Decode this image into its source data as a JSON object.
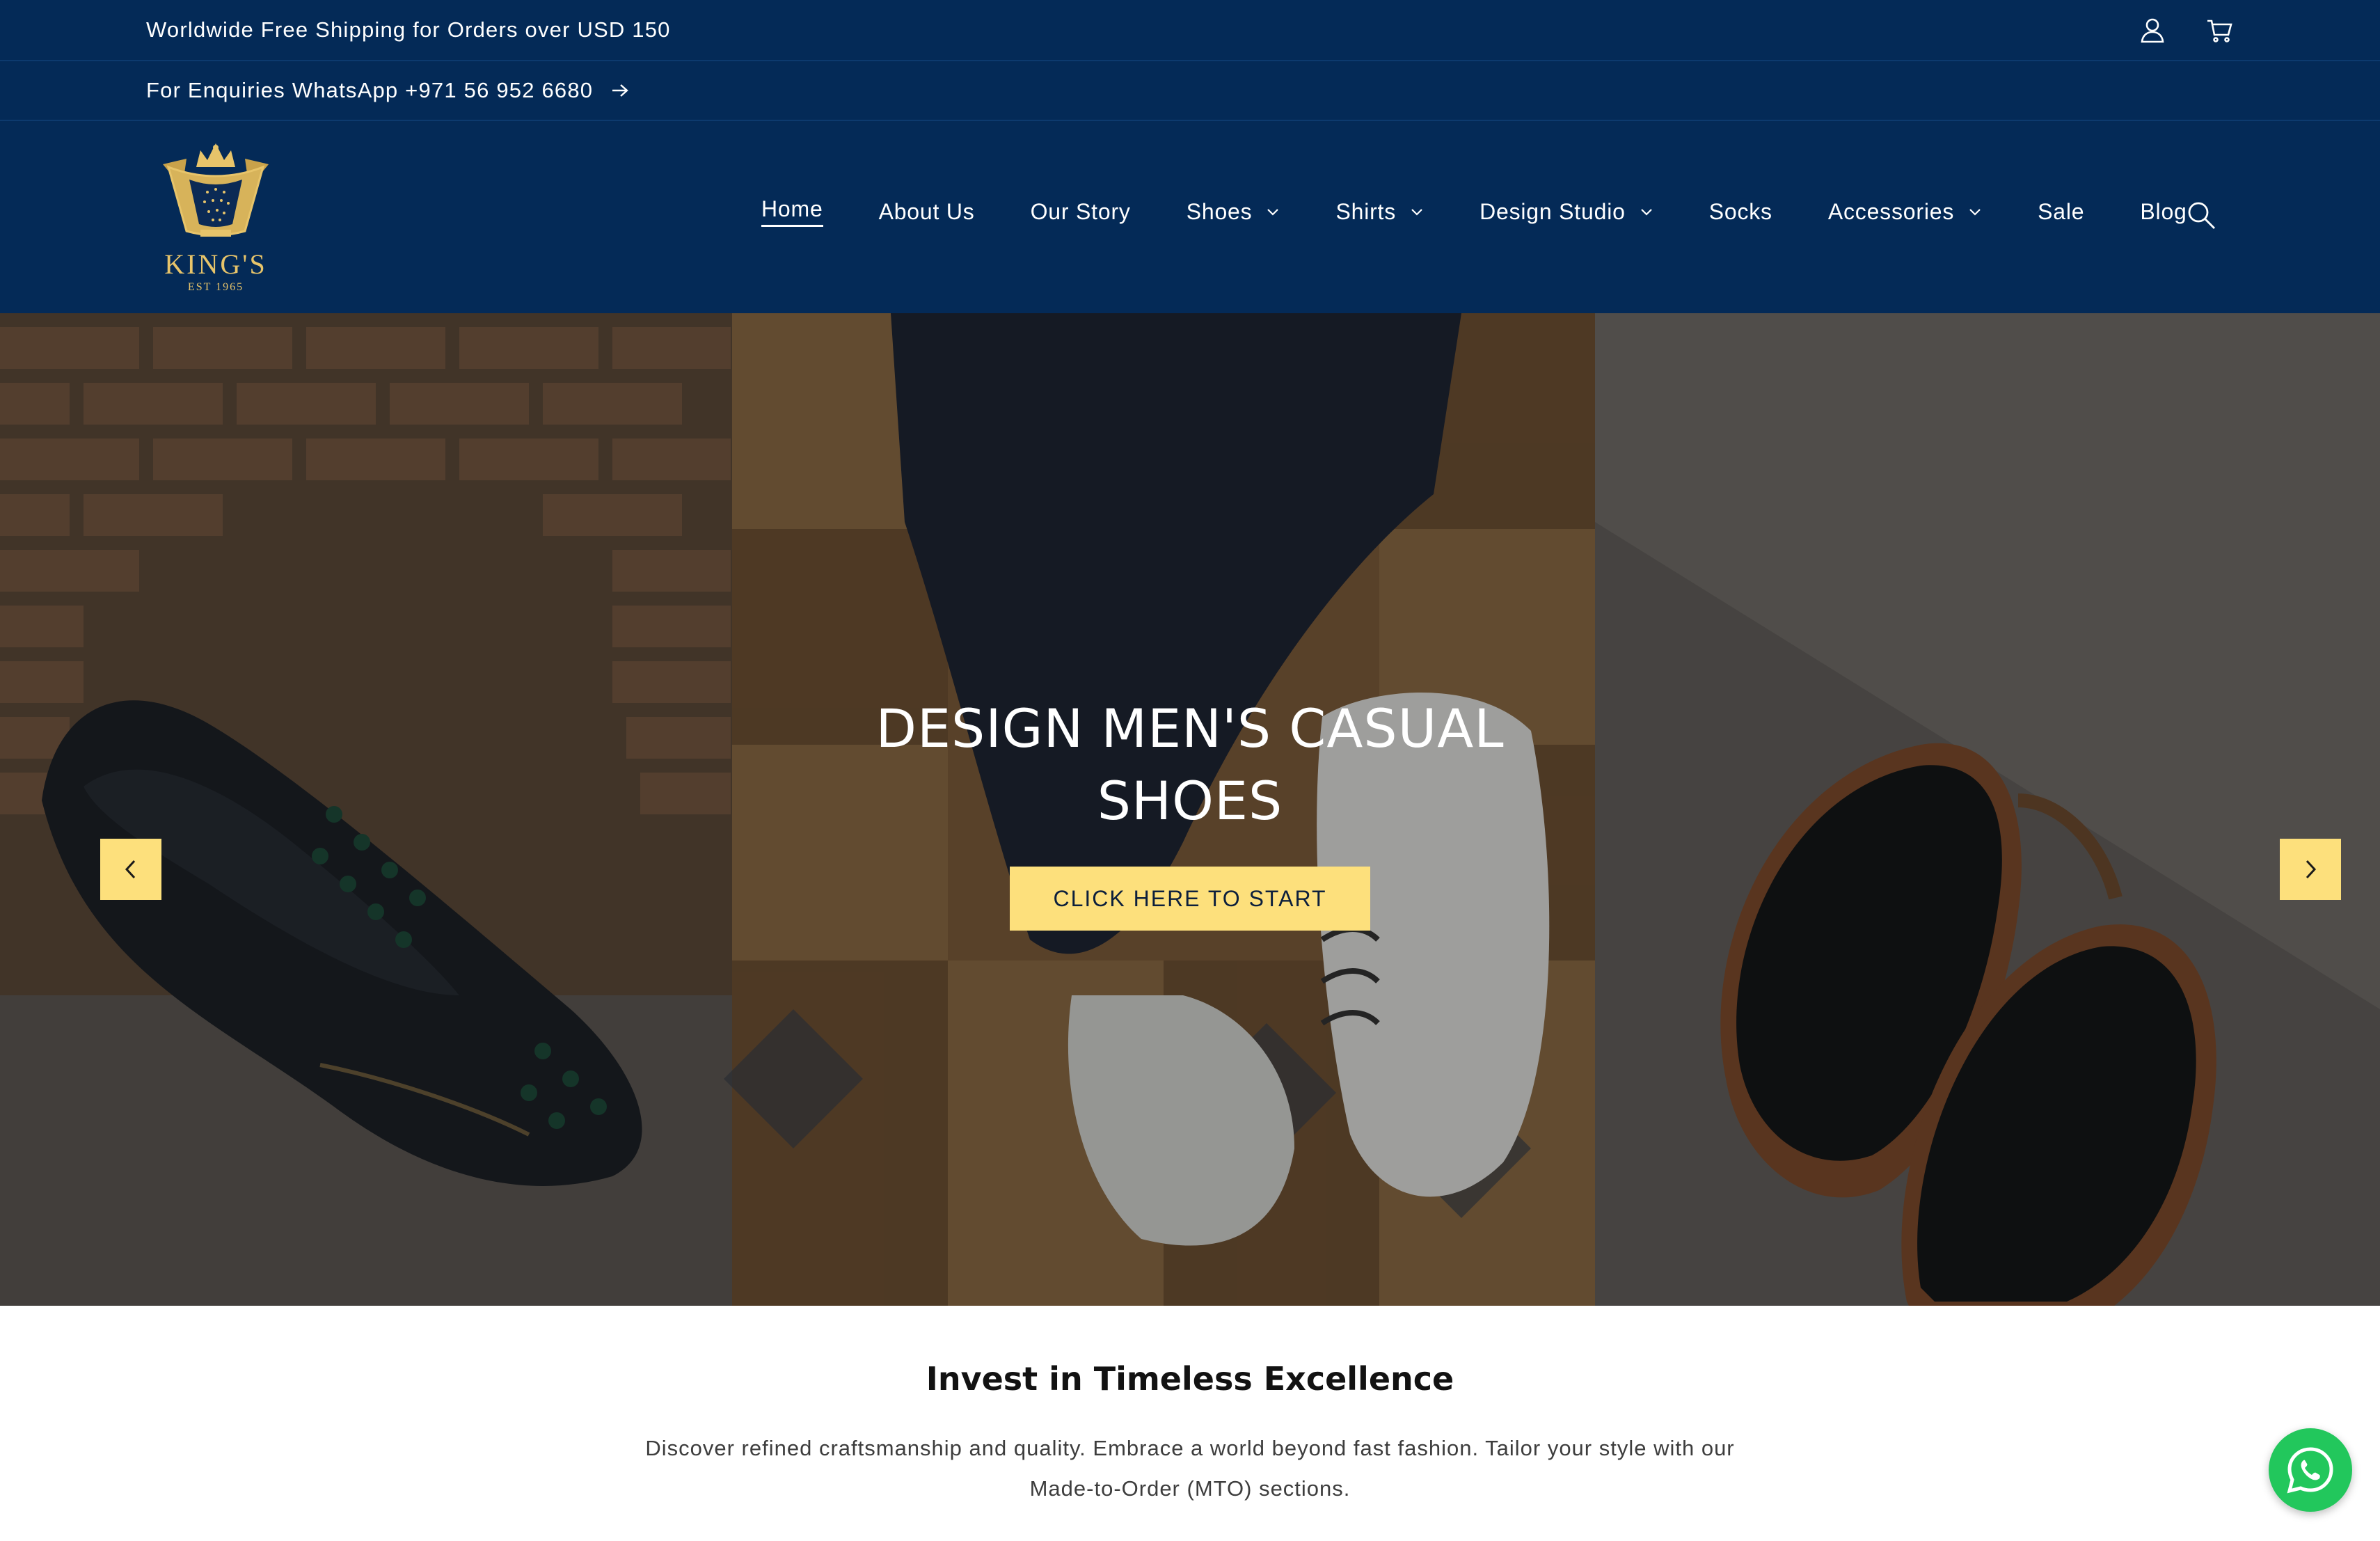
{
  "announcement": {
    "shipping_text": "Worldwide Free Shipping for Orders over USD 150",
    "enquiries_text": "For Enquiries WhatsApp +971 56 952 6680"
  },
  "header_icons": [
    "account-icon",
    "cart-icon",
    "search-icon"
  ],
  "logo": {
    "wordmark": "KING'S",
    "established": "EST 1965"
  },
  "nav": {
    "items": [
      {
        "label": "Home",
        "active": true,
        "dropdown": false
      },
      {
        "label": "About Us",
        "active": false,
        "dropdown": false
      },
      {
        "label": "Our Story",
        "active": false,
        "dropdown": false
      },
      {
        "label": "Shoes",
        "active": false,
        "dropdown": true
      },
      {
        "label": "Shirts",
        "active": false,
        "dropdown": true
      },
      {
        "label": "Design Studio",
        "active": false,
        "dropdown": true
      },
      {
        "label": "Socks",
        "active": false,
        "dropdown": false
      },
      {
        "label": "Accessories",
        "active": false,
        "dropdown": true
      },
      {
        "label": "Sale",
        "active": false,
        "dropdown": false
      },
      {
        "label": "Blog",
        "active": false,
        "dropdown": false
      }
    ]
  },
  "hero": {
    "title_line1": "DESIGN MEN'S CASUAL",
    "title_line2": "SHOES",
    "cta_label": "CLICK HERE TO START"
  },
  "intro": {
    "title": "Invest in Timeless Excellence",
    "body": "Discover refined craftsmanship and quality. Embrace a world beyond fast fashion. Tailor your style with our Made-to-Order (MTO) sections."
  },
  "colors": {
    "navy": "#042a57",
    "accent_yellow": "#fde07c",
    "gold": "#e7c46a",
    "whatsapp_green": "#22c75c"
  }
}
